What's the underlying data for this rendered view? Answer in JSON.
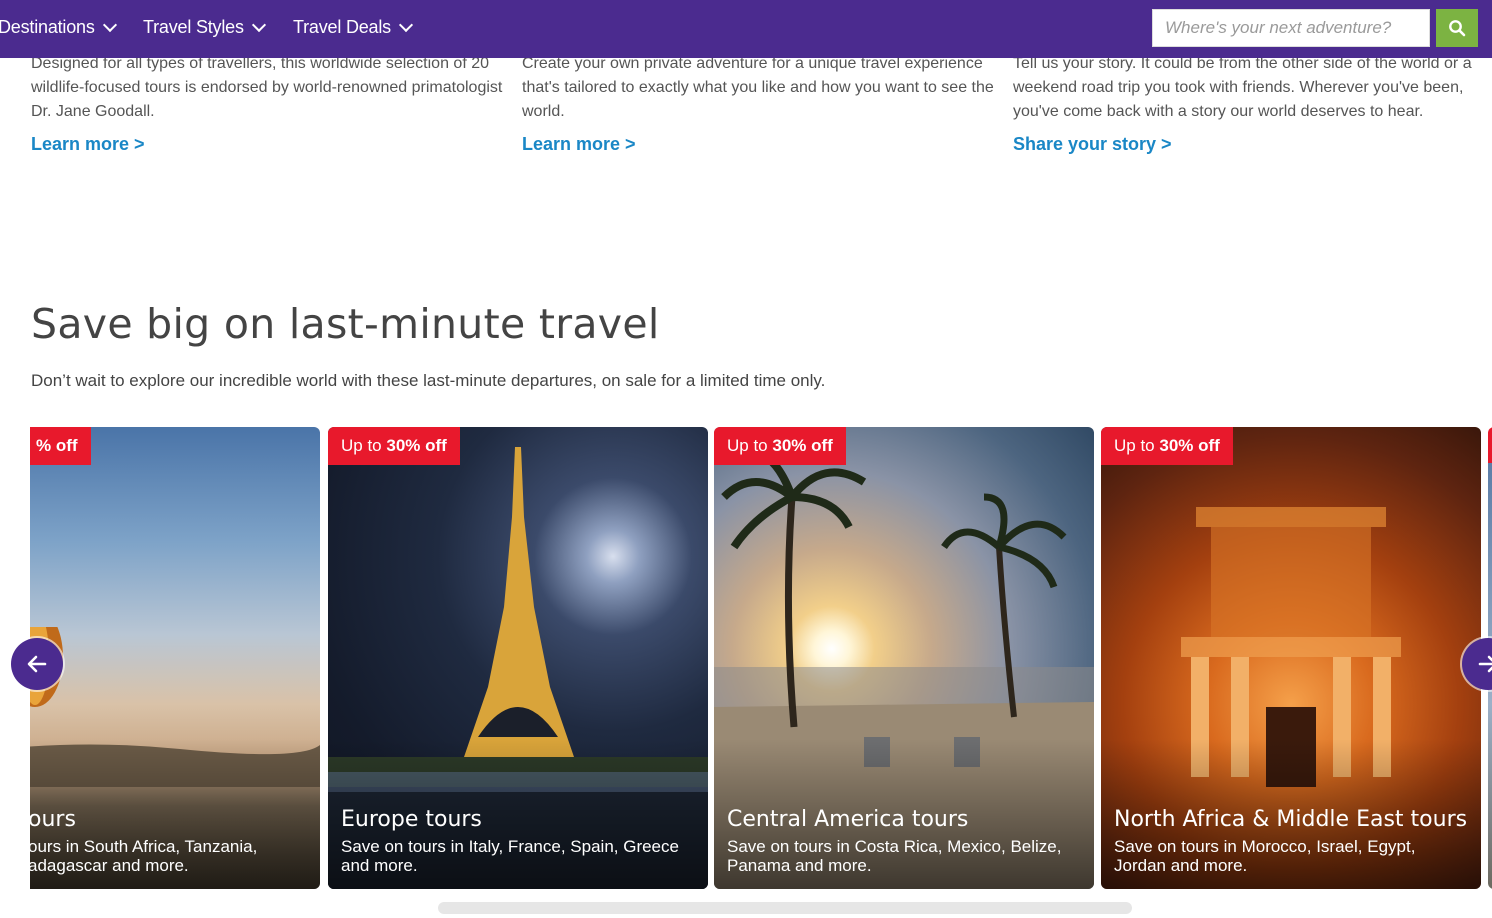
{
  "nav": {
    "items": [
      {
        "label": "Destinations"
      },
      {
        "label": "Travel Styles"
      },
      {
        "label": "Travel Deals"
      }
    ],
    "search_placeholder": "Where's your next adventure?",
    "brand_color": "#4b2b8f",
    "search_button_color": "#7cb342"
  },
  "intro": [
    {
      "partial_line": "Designed for all types of travellers, this worldwide selection of 20",
      "text": "wildlife-focused tours is endorsed by world-renowned primatologist Dr. Jane Goodall.",
      "link": "Learn more >"
    },
    {
      "partial_line": "Create your own private adventure for a unique travel experience",
      "text": "that's tailored to exactly what you like and how you want to see the world.",
      "link": "Learn more >"
    },
    {
      "partial_line": "Tell us your story. It could be from the other side of the world or a",
      "text": "weekend road trip you took with friends. Wherever you've been, you've come back with a story our world deserves to hear.",
      "link": "Share your story >"
    }
  ],
  "section": {
    "title": "Save big on last-minute travel",
    "subtitle": "Don’t wait to explore our incredible world with these last-minute departures, on sale for a limited time only."
  },
  "cards": [
    {
      "badge": "% off",
      "title": "ours",
      "desc": "ours in South Africa, Tanzania, adagascar and more."
    },
    {
      "badge_prefix": "Up to ",
      "badge_bold": "30% off",
      "title": "Europe tours",
      "desc": "Save on tours in Italy, France, Spain, Greece and more."
    },
    {
      "badge_prefix": "Up to ",
      "badge_bold": "30% off",
      "title": "Central America tours",
      "desc": "Save on tours in Costa Rica, Mexico, Belize, Panama and more."
    },
    {
      "badge_prefix": "Up to ",
      "badge_bold": "30% off",
      "title": "North Africa & Middle East tours",
      "desc": "Save on tours in Morocco, Israel, Egypt, Jordan and more."
    }
  ],
  "badge_color": "#e8192c",
  "link_color": "#1a87c6",
  "icons": {
    "search": "search-icon",
    "prev": "arrow-left-icon",
    "next": "arrow-right-icon"
  }
}
